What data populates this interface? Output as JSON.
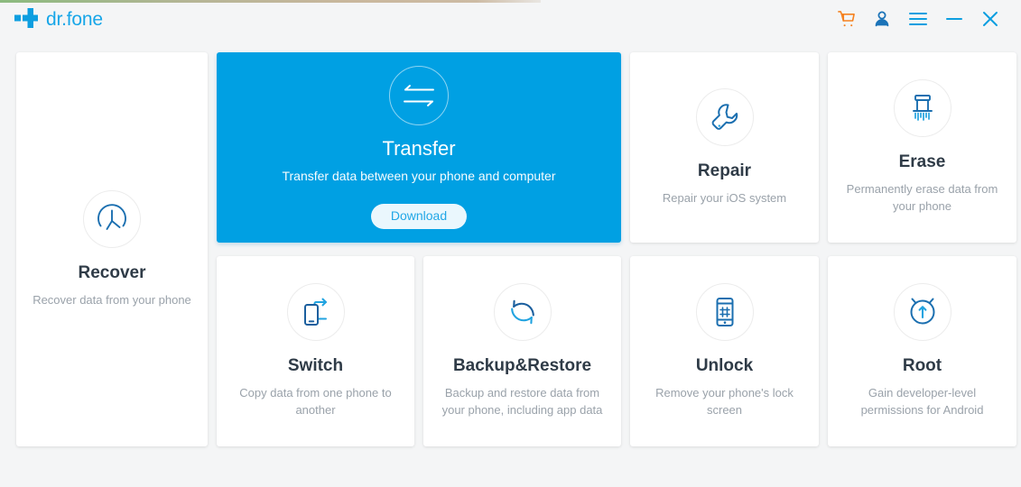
{
  "app": {
    "brand_name": "dr.fone",
    "logo_icon": "plus-cross-logo"
  },
  "titlebar": {
    "actions": [
      {
        "name": "cart-icon",
        "label": "Shopping Cart",
        "color": "#f58220"
      },
      {
        "name": "account-icon",
        "label": "Account",
        "color": "#1b73b8"
      },
      {
        "name": "menu-icon",
        "label": "Menu",
        "color": "#0d9ee0"
      },
      {
        "name": "minimize-icon",
        "label": "Minimize",
        "color": "#0d9ee0"
      },
      {
        "name": "close-icon",
        "label": "Close",
        "color": "#0d9ee0"
      }
    ]
  },
  "colors": {
    "accent_blue": "#00a0e3",
    "icon_blue": "#1b6fb0",
    "cart_orange": "#f58220",
    "page_background": "#f4f5f6",
    "card_background": "#ffffff",
    "title_text": "#2f3b47",
    "desc_text": "#9aa2aa"
  },
  "cards": {
    "recover": {
      "title": "Recover",
      "desc": "Recover data from your phone",
      "icon": "clock-recover-icon"
    },
    "transfer": {
      "title": "Transfer",
      "desc": "Transfer data between your phone and computer",
      "icon": "two-way-arrows-icon",
      "download_label": "Download",
      "featured": true
    },
    "repair": {
      "title": "Repair",
      "desc": "Repair your iOS system",
      "icon": "wrench-icon"
    },
    "erase": {
      "title": "Erase",
      "desc": "Permanently erase data from your phone",
      "icon": "shredder-erase-icon"
    },
    "switch": {
      "title": "Switch",
      "desc": "Copy data from one phone to another",
      "icon": "two-phones-arrow-icon"
    },
    "backup_restore": {
      "title": "Backup&Restore",
      "desc": "Backup and restore data from your phone, including app data",
      "icon": "circular-sync-icon"
    },
    "unlock": {
      "title": "Unlock",
      "desc": "Remove your phone's lock screen",
      "icon": "phone-lockscreen-icon"
    },
    "root": {
      "title": "Root",
      "desc": "Gain developer-level permissions for Android",
      "icon": "android-root-icon"
    }
  }
}
